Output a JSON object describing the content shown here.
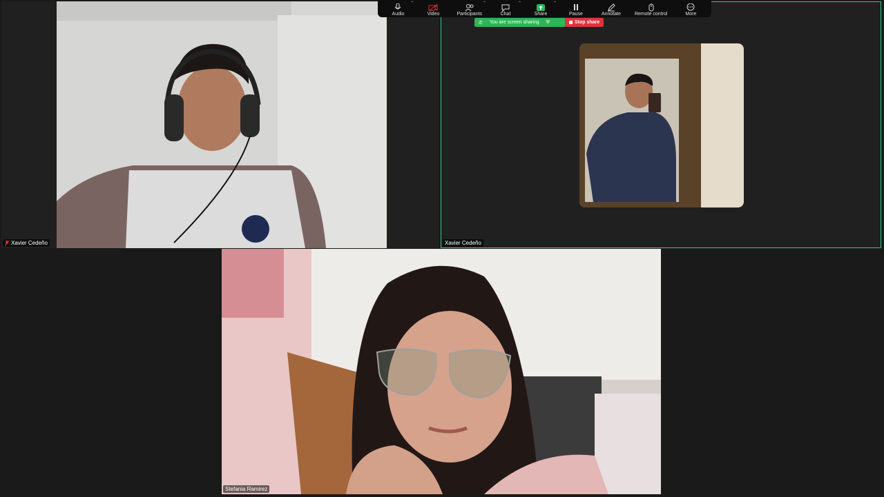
{
  "toolbar": {
    "audio": "Audio",
    "video": "Video",
    "participants": "Participants",
    "chat": "Chat",
    "share": "Share",
    "pause": "Pause",
    "annotate": "Annotate",
    "remote_control": "Remote control",
    "more": "More"
  },
  "banner": {
    "status": "You are screen sharing",
    "stop": "Stop share"
  },
  "participants": [
    {
      "name": "Xavier Cedeño",
      "muted": true
    },
    {
      "name": "Xavier Cedeño",
      "muted": false
    },
    {
      "name": "Stefania Ramirez",
      "muted": false
    }
  ],
  "colors": {
    "active_speaker_border": "#2ecc8f",
    "share_green": "#2fb556",
    "stop_red": "#e0343a"
  }
}
